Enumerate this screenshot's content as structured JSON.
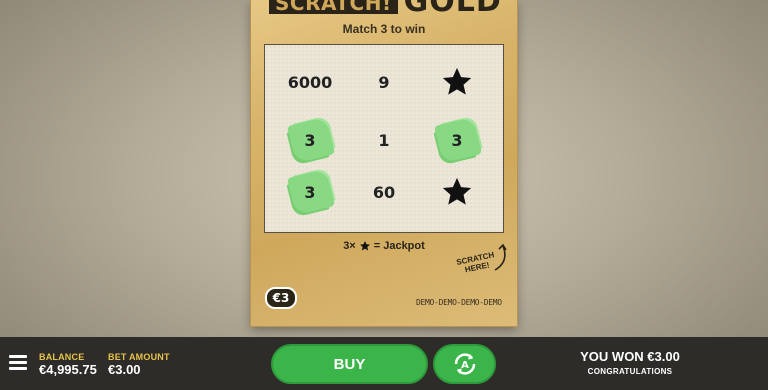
{
  "ticket": {
    "logo_left": "SCRATCH!",
    "logo_right": "GOLD",
    "subtitle": "Match 3 to win",
    "grid": [
      [
        {
          "value": "6000",
          "win": false
        },
        {
          "value": "9",
          "win": false
        },
        {
          "value": "",
          "icon": "star-icon",
          "win": false
        }
      ],
      [
        {
          "value": "3",
          "win": true
        },
        {
          "value": "1",
          "win": false
        },
        {
          "value": "3",
          "win": true
        }
      ],
      [
        {
          "value": "3",
          "win": true
        },
        {
          "value": "60",
          "win": false
        },
        {
          "value": "",
          "icon": "star-icon",
          "win": false
        }
      ]
    ],
    "jackpot_prefix": "3×",
    "jackpot_suffix": "= Jackpot",
    "scratch_hint_line1": "SCRATCH",
    "scratch_hint_line2": "HERE!",
    "price": "€3",
    "demo": "DEMO-DEMO-DEMO-DEMO"
  },
  "bottom_bar": {
    "balance_label": "BALANCE",
    "balance_value": "€4,995.75",
    "bet_label": "BET AMOUNT",
    "bet_value": "€3.00",
    "buy_label": "BUY",
    "win_text": "YOU WON €3.00",
    "congrats_text": "CONGRATULATIONS"
  },
  "colors": {
    "ticket_gold": "#d8b46a",
    "win_green": "#7fd77a",
    "button_green": "#3bb54a",
    "label_yellow": "#e6c34a",
    "bar_dark": "#2e2c29"
  }
}
